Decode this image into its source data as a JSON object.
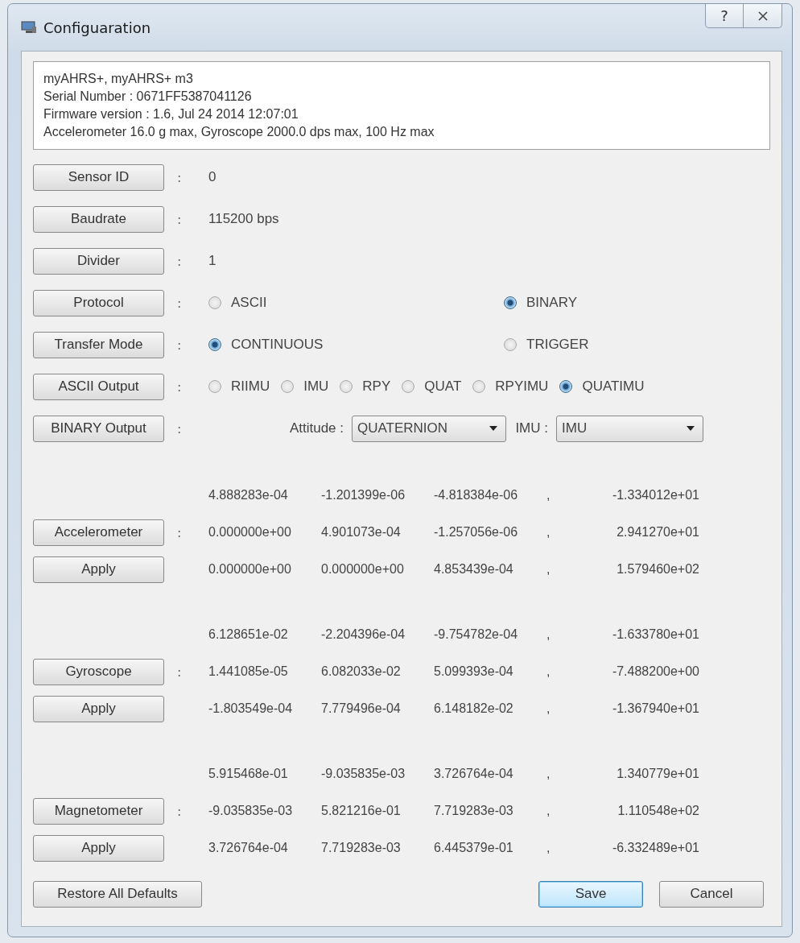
{
  "window": {
    "title": "Configuaration",
    "help": "?"
  },
  "info_lines": [
    "myAHRS+, myAHRS+ m3",
    "Serial Number : 0671FF5387041126",
    "Firmware version :  1.6, Jul 24 2014 12:07:01",
    "Accelerometer 16.0 g max, Gyroscope 2000.0 dps max, 100 Hz max"
  ],
  "settings": [
    {
      "kind": "text",
      "button": "Sensor ID",
      "separator": ":",
      "value": "0"
    },
    {
      "kind": "text",
      "button": "Baudrate",
      "separator": ":",
      "value": "115200 bps"
    },
    {
      "kind": "text",
      "button": "Divider",
      "separator": ":",
      "value": "1"
    },
    {
      "kind": "radio",
      "button": "Protocol",
      "separator": ":",
      "options": [
        {
          "label": "ASCII",
          "selected": false
        },
        {
          "label": "BINARY",
          "selected": true
        }
      ]
    },
    {
      "kind": "radio",
      "button": "Transfer Mode",
      "separator": ":",
      "options": [
        {
          "label": "CONTINUOUS",
          "selected": true
        },
        {
          "label": "TRIGGER",
          "selected": false
        }
      ]
    },
    {
      "kind": "radio_row",
      "button": "ASCII Output",
      "separator": ":",
      "options": [
        {
          "label": "RIIMU",
          "selected": false
        },
        {
          "label": "IMU",
          "selected": false
        },
        {
          "label": "RPY",
          "selected": false
        },
        {
          "label": "QUAT",
          "selected": false
        },
        {
          "label": "RPYIMU",
          "selected": false
        },
        {
          "label": "QUATIMU",
          "selected": true
        }
      ]
    },
    {
      "kind": "dropdowns",
      "button": "BINARY Output",
      "separator": ":",
      "dropdowns": [
        {
          "label": "Attitude :",
          "value": "QUATERNION"
        },
        {
          "label": "IMU :",
          "value": "IMU"
        }
      ]
    }
  ],
  "calibrations": [
    {
      "button": "Accelerometer",
      "separator": ":",
      "apply": "Apply",
      "rows": [
        {
          "values": [
            "4.888283e-04",
            "-1.201399e-06",
            "-4.818384e-06"
          ],
          "comma": ",",
          "offset": "-1.334012e+01"
        },
        {
          "values": [
            "0.000000e+00",
            "4.901073e-04",
            "-1.257056e-06"
          ],
          "comma": ",",
          "offset": "2.941270e+01"
        },
        {
          "values": [
            "0.000000e+00",
            "0.000000e+00",
            "4.853439e-04"
          ],
          "comma": ",",
          "offset": "1.579460e+02"
        }
      ]
    },
    {
      "button": "Gyroscope",
      "separator": ":",
      "apply": "Apply",
      "rows": [
        {
          "values": [
            "6.128651e-02",
            "-2.204396e-04",
            "-9.754782e-04"
          ],
          "comma": ",",
          "offset": "-1.633780e+01"
        },
        {
          "values": [
            "1.441085e-05",
            "6.082033e-02",
            "5.099393e-04"
          ],
          "comma": ",",
          "offset": "-7.488200e+00"
        },
        {
          "values": [
            "-1.803549e-04",
            "7.779496e-04",
            "6.148182e-02"
          ],
          "comma": ",",
          "offset": "-1.367940e+01"
        }
      ]
    },
    {
      "button": "Magnetometer",
      "separator": ":",
      "apply": "Apply",
      "rows": [
        {
          "values": [
            "5.915468e-01",
            "-9.035835e-03",
            "3.726764e-04"
          ],
          "comma": ",",
          "offset": "1.340779e+01"
        },
        {
          "values": [
            "-9.035835e-03",
            "5.821216e-01",
            "7.719283e-03"
          ],
          "comma": ",",
          "offset": "1.110548e+02"
        },
        {
          "values": [
            "3.726764e-04",
            "7.719283e-03",
            "6.445379e-01"
          ],
          "comma": ",",
          "offset": "-6.332489e+01"
        }
      ]
    }
  ],
  "footer": {
    "restore": "Restore All Defaults",
    "buttons": [
      {
        "label": "Save",
        "default": true
      },
      {
        "label": "Cancel",
        "default": false
      }
    ]
  }
}
